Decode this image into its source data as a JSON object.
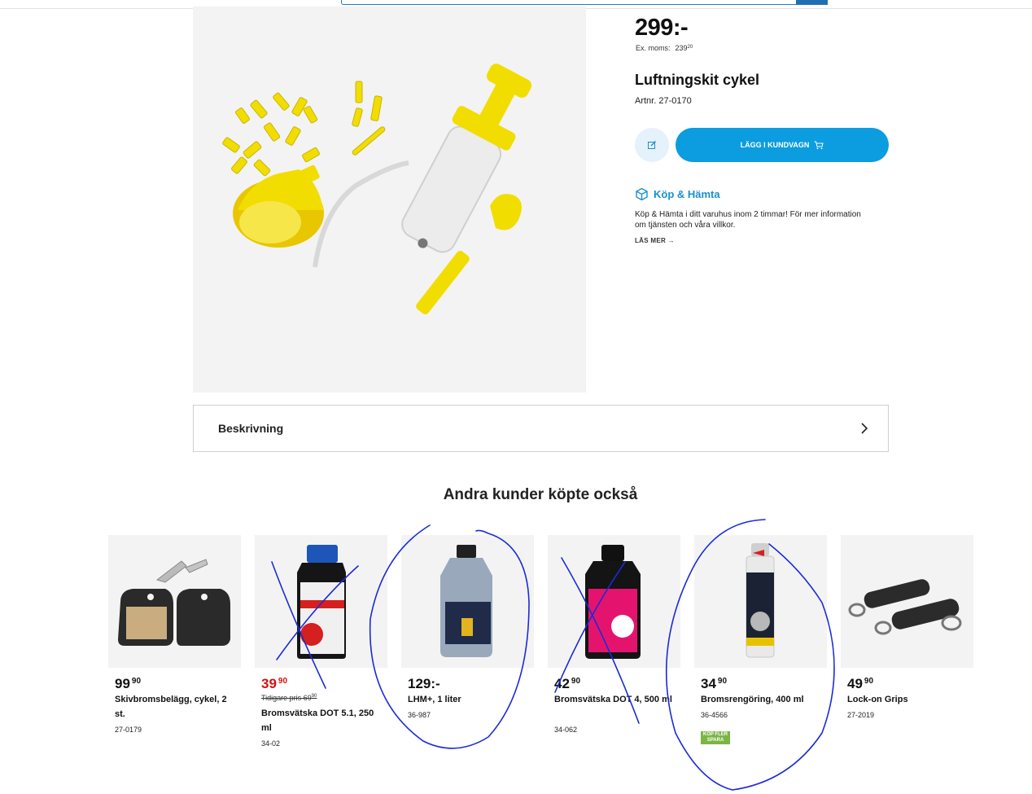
{
  "product": {
    "price": "299:-",
    "ex_vat_label": "Ex. moms:",
    "ex_vat_value": "239",
    "ex_vat_decimals": "20",
    "title": "Luftningskit cykel",
    "artnr": "Artnr. 27-0170",
    "image_icon": "bleed-kit-image",
    "edit_icon": "edit-icon",
    "add_to_cart_label": "LÄGG I KUNDVAGN",
    "cart_icon": "cart-icon"
  },
  "pickup": {
    "title": "Köp & Hämta",
    "icon": "box-icon",
    "text": "Köp & Hämta i ditt varuhus inom 2 timmar! För mer information om tjänsten och våra villkor.",
    "read_more": "LÄS MER"
  },
  "description": {
    "label": "Beskrivning"
  },
  "recommendations": {
    "title": "Andra kunder köpte också",
    "items": [
      {
        "price": "99",
        "decimals": "90",
        "name": "Skivbromsbelägg, cykel, 2 st.",
        "artnr": "27-0179",
        "image": "brake-pads-image"
      },
      {
        "price": "39",
        "decimals": "90",
        "previous": "Tidigare pris 69",
        "previous_decimals": "90",
        "name": "Bromsvätska DOT 5.1, 250 ml",
        "artnr": "34-02",
        "image": "brake-fluid-bottle-image"
      },
      {
        "price": "129:-",
        "name": "LHM+, 1 liter",
        "artnr": "36-987",
        "image": "hydraulic-fluid-bottle-image"
      },
      {
        "price": "42",
        "decimals": "90",
        "name": "Bromsvätska DOT 4, 500 ml",
        "artnr": "34-062",
        "image": "dot4-bottle-image"
      },
      {
        "price": "34",
        "decimals": "90",
        "name": "Bromsrengöring, 400 ml",
        "artnr": "36-4566",
        "badge": "KÖP FLER SPARA",
        "image": "brake-cleaner-spray-image"
      },
      {
        "price": "49",
        "decimals": "90",
        "name": "Lock-on Grips",
        "artnr": "27-2019",
        "image": "grips-image"
      }
    ]
  },
  "colors": {
    "accent": "#0c9ce0",
    "sale": "#d41010",
    "annotation": "#1a2bd8",
    "product_yellow": "#f2dd00"
  }
}
